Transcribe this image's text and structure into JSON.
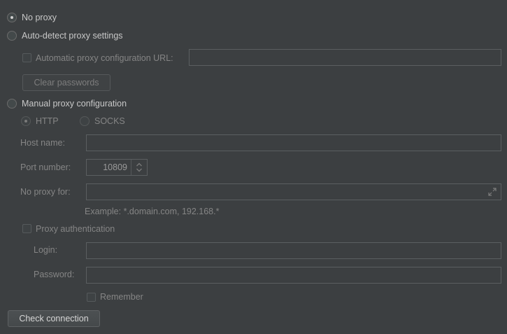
{
  "proxy": {
    "no_proxy_label": "No proxy",
    "auto_detect_label": "Auto-detect proxy settings",
    "auto_config_url_label": "Automatic proxy configuration URL:",
    "auto_config_url_value": "",
    "clear_passwords_label": "Clear passwords",
    "manual_label": "Manual proxy configuration",
    "http_label": "HTTP",
    "socks_label": "SOCKS",
    "host_label": "Host name:",
    "host_value": "",
    "port_label": "Port number:",
    "port_value": "10809",
    "no_proxy_for_label": "No proxy for:",
    "no_proxy_for_value": "",
    "example_text": "Example: *.domain.com, 192.168.*",
    "auth_label": "Proxy authentication",
    "login_label": "Login:",
    "login_value": "",
    "password_label": "Password:",
    "password_value": "",
    "remember_label": "Remember",
    "check_connection_label": "Check connection"
  },
  "icons": {
    "spinner": "up-down-arrows-icon",
    "expand": "expand-diagonal-icon"
  },
  "colors": {
    "background": "#3c3f41",
    "text_enabled": "#c8c8c8",
    "text_disabled": "#858585"
  }
}
